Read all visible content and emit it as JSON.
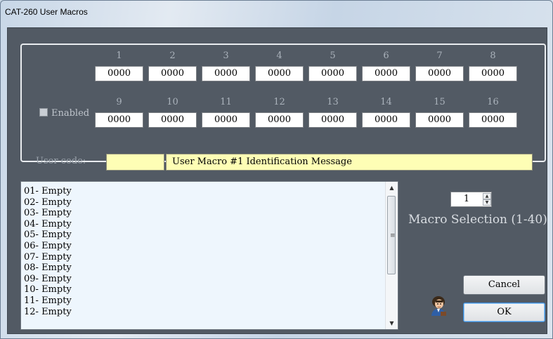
{
  "window": {
    "title": "CAT-260 User Macros"
  },
  "macro_group": {
    "enabled_label": "Enabled",
    "enabled_checked": false,
    "row1_numbers": [
      "1",
      "2",
      "3",
      "4",
      "5",
      "6",
      "7",
      "8"
    ],
    "row1_values": [
      "0000",
      "0000",
      "0000",
      "0000",
      "0000",
      "0000",
      "0000",
      "0000"
    ],
    "row2_numbers": [
      "9",
      "10",
      "11",
      "12",
      "13",
      "14",
      "15",
      "16"
    ],
    "row2_values": [
      "0000",
      "0000",
      "0000",
      "0000",
      "0000",
      "0000",
      "0000",
      "0000"
    ],
    "user_code_label": "User code:",
    "user_code_value": "",
    "message_value": "User Macro #1 Identification Message"
  },
  "macro_list": {
    "items": [
      "01- Empty",
      "02- Empty",
      "03- Empty",
      "04- Empty",
      "05- Empty",
      "06- Empty",
      "07- Empty",
      "08- Empty",
      "09- Empty",
      "10- Empty",
      "11- Empty",
      "12- Empty"
    ]
  },
  "macro_selection": {
    "value": "1",
    "label": "Macro Selection (1-40)"
  },
  "buttons": {
    "cancel": "Cancel",
    "ok": "OK"
  },
  "colors": {
    "accent": "#3c8ad6",
    "field_yellow": "#fefeb5",
    "panel_bg": "#525a64",
    "list_bg": "#eef6fd"
  }
}
